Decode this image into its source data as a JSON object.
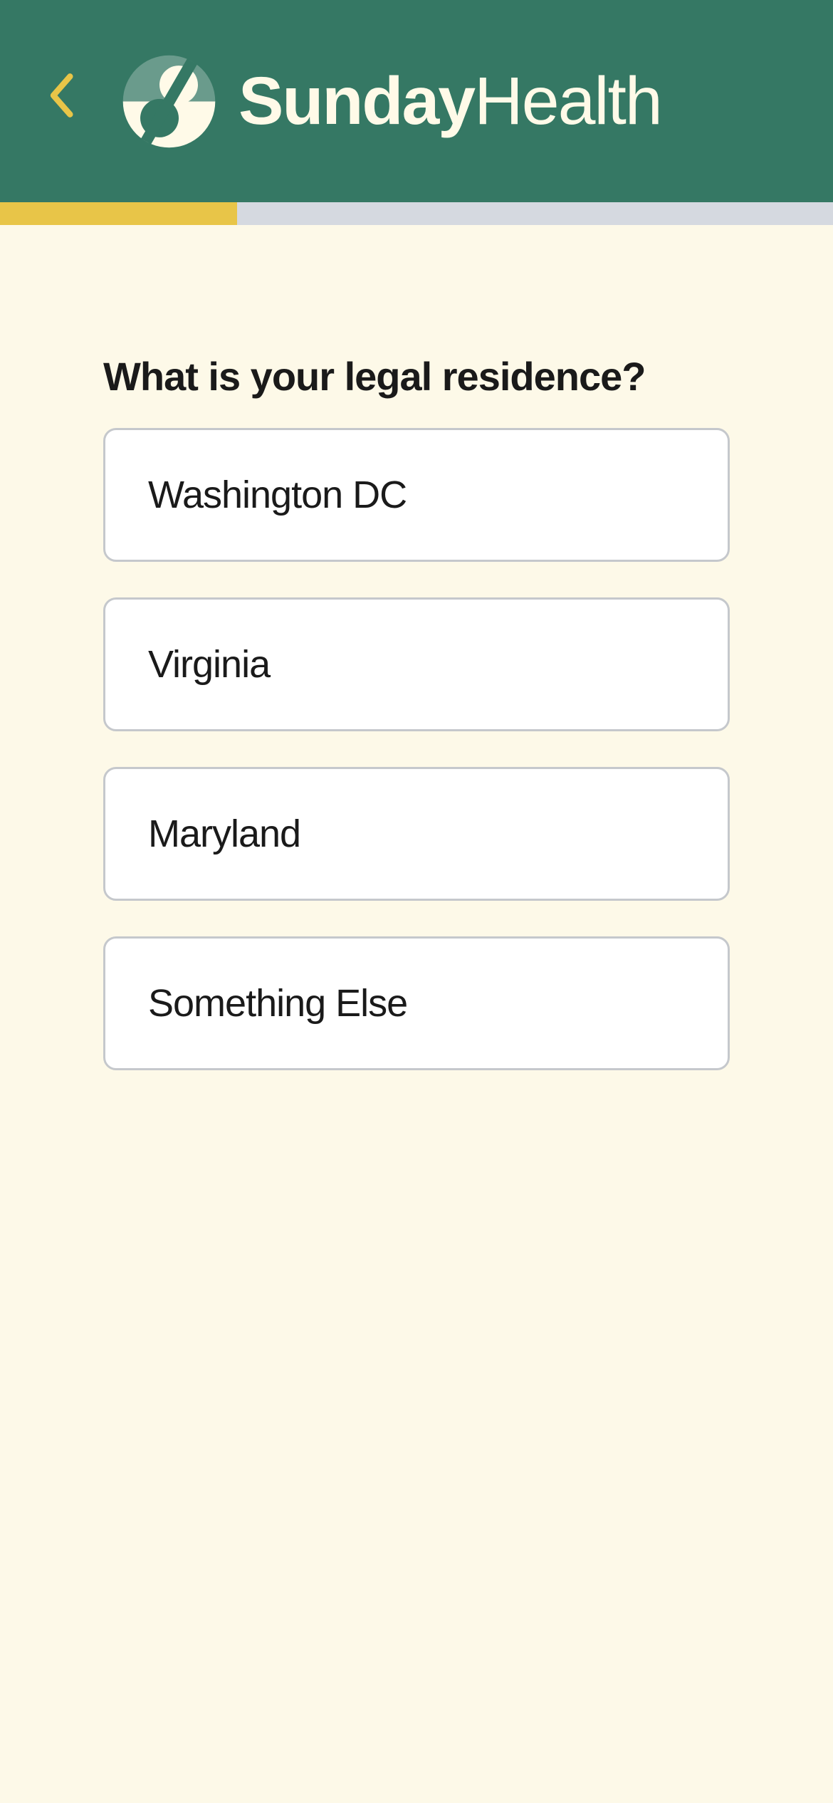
{
  "header": {
    "brand_name_bold": "Sunday",
    "brand_name_regular": "Health"
  },
  "progress": {
    "percent": 28.5
  },
  "question": {
    "text": "What is your legal residence?"
  },
  "options": [
    {
      "label": "Washington DC"
    },
    {
      "label": "Virginia"
    },
    {
      "label": "Maryland"
    },
    {
      "label": "Something Else"
    }
  ]
}
